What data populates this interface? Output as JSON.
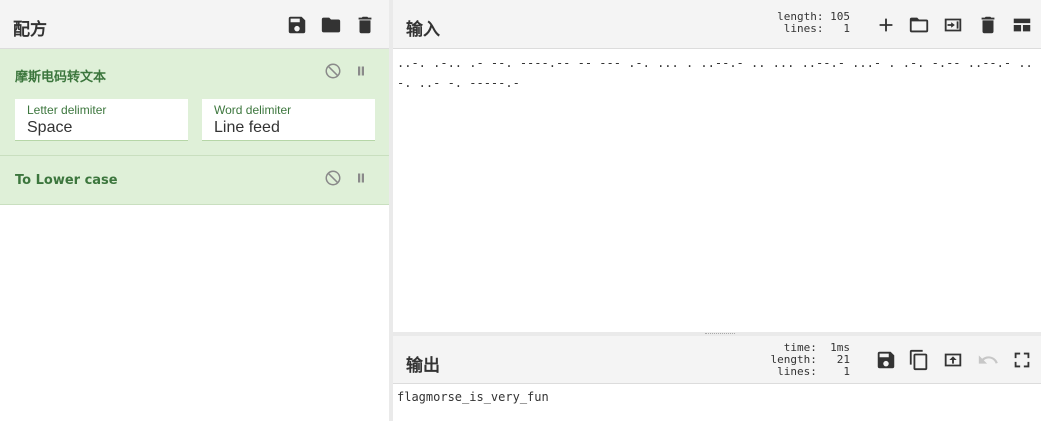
{
  "recipe": {
    "title": "配方",
    "icons": [
      "save-icon",
      "folder-icon",
      "trash-icon"
    ],
    "operations": [
      {
        "name": "摩斯电码转文本",
        "args": [
          {
            "label": "Letter delimiter",
            "value": "Space"
          },
          {
            "label": "Word delimiter",
            "value": "Line feed"
          }
        ]
      },
      {
        "name": "To Lower case",
        "args": []
      }
    ]
  },
  "input": {
    "title": "输入",
    "stats": "length: 105\n lines:   1",
    "text": "..-. .-.. .- --. ----.-- -- --- .-. ... . ..--.- .. ... ..--.- ...- . .-. -.-- ..--.- ..-. ..- -. -----.-",
    "icons": [
      "plus-icon",
      "folder-icon",
      "import-icon",
      "trash-icon",
      "layout-icon"
    ]
  },
  "output": {
    "title": "输出",
    "stats": "  time:  1ms\nlength:   21\n lines:    1",
    "text": "flagmorse_is_very_fun",
    "icons": [
      "save-icon",
      "copy-icon",
      "replace-input-icon",
      "undo-icon",
      "fullscreen-icon"
    ]
  }
}
